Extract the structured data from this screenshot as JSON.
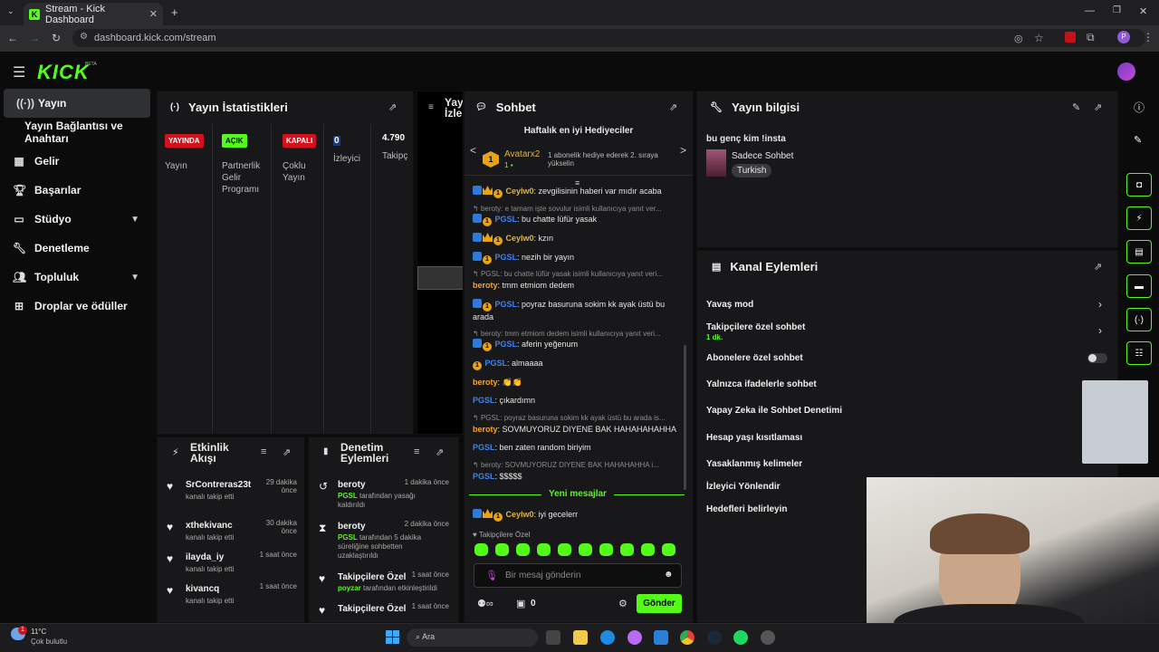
{
  "browser": {
    "tab_title": "Stream - Kick Dashboard",
    "url": "dashboard.kick.com/stream"
  },
  "kick": {
    "logo": "KICK",
    "beta": "BETA"
  },
  "sidebar": {
    "items": [
      {
        "label": "Yayın",
        "icon": "broadcast-icon",
        "active": true
      },
      {
        "label": "Yayın Bağlantısı ve Anahtarı",
        "icon": "",
        "active": false
      },
      {
        "label": "Gelir",
        "icon": "revenue-icon"
      },
      {
        "label": "Başarılar",
        "icon": "trophy-icon"
      },
      {
        "label": "Stüdyo",
        "icon": "studio-icon"
      },
      {
        "label": "Denetleme",
        "icon": "wrench-icon"
      },
      {
        "label": "Topluluk",
        "icon": "community-icon"
      },
      {
        "label": "Droplar ve ödüller",
        "icon": "drops-icon"
      }
    ]
  },
  "stats": {
    "title": "Yayın İstatistikleri",
    "cols": [
      {
        "badge": "YAYINDA",
        "badge_color": "#d4101c",
        "label": "Yayın"
      },
      {
        "badge": "AÇIK",
        "badge_color": "#53fc18",
        "label": "Partnerlik Gelir Programı"
      },
      {
        "badge": "KAPALI",
        "badge_color": "#d4101c",
        "label": "Çoklu Yayın"
      },
      {
        "value": "0",
        "label": "İzleyici"
      },
      {
        "value": "4.790",
        "label": "Takipç"
      }
    ]
  },
  "player": {
    "title_line1": "Yay",
    "title_line2": "İzle"
  },
  "chat": {
    "title": "Sohbet",
    "top_gifters_title": "Haftalık en iyi Hediyeciler",
    "gifter_name": "Avatarx2",
    "gifter_count": "1",
    "gifter_note": "1 abonelik hediye ederek 2. sıraya yükselin",
    "messages": [
      {
        "user": "Ceylw0",
        "text": ": zevgilisinin haberi var mıdır acaba",
        "color": "gold"
      },
      {
        "reply": "beroty: e tamam işte sovulur isimli kullanıcıya yanıt ver..."
      },
      {
        "user": "PGSL",
        "text": ": bu chatte lüfür yasak",
        "color": "blue"
      },
      {
        "user": "Ceylw0",
        "text": ": kzın",
        "color": "gold"
      },
      {
        "user": "PGSL",
        "text": ": nezih bir yayın",
        "color": "blue"
      },
      {
        "reply": "PGSL: bu chatte lüfür yasak isimli kullanıcıya yanıt veri..."
      },
      {
        "user": "beroty",
        "text": ": tmm etmiom dedem",
        "color": "org"
      },
      {
        "user": "PGSL",
        "text": ": poyraz basuruna sokim kk ayak üstü bu arada",
        "color": "blue"
      },
      {
        "reply": "beroty: tmm etmiom dedem isimli kullanıcıya yanıt veri..."
      },
      {
        "user": "PGSL",
        "text": ": aferin yeğenum",
        "color": "blue"
      },
      {
        "user": "PGSL",
        "text": ": almaaaa",
        "color": "blue"
      },
      {
        "user": "beroty",
        "text": ": 👏👏",
        "color": "org"
      },
      {
        "user": "PGSL",
        "text": ": çıkardımn",
        "color": "blue"
      },
      {
        "reply": "PGSL: poyraz basuruna sokim kk ayak üstü bu arada is..."
      },
      {
        "user": "beroty",
        "text": ": SOVMUYORUZ DIYENE BAK HAHAHAHAHHA",
        "color": "org"
      },
      {
        "user": "PGSL",
        "text": ": ben zaten random biriyim",
        "color": "blue"
      },
      {
        "reply": "beroty: SOVMUYORUZ DIYENE BAK HAHAHAHHA i..."
      },
      {
        "user": "PGSL",
        "text": ": $$$$$",
        "color": "blue"
      }
    ],
    "new_messages": "Yeni mesajlar",
    "last_msg_user": "Ceylw0",
    "last_msg_text": ": iyi gecelerr",
    "followers_only": "Takipçilere Özel",
    "input_placeholder": "Bir mesaj gönderin",
    "footer_count": "0",
    "send": "Gönder"
  },
  "stream_info": {
    "title": "Yayın bilgisi",
    "stream_title": "bu genç kim !insta",
    "category": "Sadece Sohbet",
    "tag": "Turkish"
  },
  "channel_actions": {
    "title": "Kanal Eylemleri",
    "rows": [
      {
        "label": "Yavaş mod"
      },
      {
        "label": "Takipçilere özel sohbet",
        "sub": "1 dk."
      },
      {
        "label": "Abonelere özel sohbet"
      },
      {
        "label": "Yalnızca ifadelerle sohbet"
      },
      {
        "label": "Yapay Zeka ile Sohbet Denetimi"
      },
      {
        "label": "Hesap yaşı kısıtlaması"
      },
      {
        "label": "Yasaklanmış kelimeler"
      },
      {
        "label": "İzleyici Yönlendir"
      },
      {
        "label": "Hedefleri belirleyin"
      }
    ]
  },
  "activity": {
    "title_line1": "Etkinlik",
    "title_line2": "Akışı",
    "items": [
      {
        "name": "SrContreras23t",
        "sub": "kanalı takip etti",
        "time": "29 dakika önce"
      },
      {
        "name": "xthekivanc",
        "sub": "kanalı takip etti",
        "time": "30 dakika önce"
      },
      {
        "name": "ilayda_iy",
        "sub": "kanalı takip etti",
        "time": "1 saat önce"
      },
      {
        "name": "kivancq",
        "sub": "kanalı takip etti",
        "time": "1 saat önce"
      }
    ]
  },
  "moderation": {
    "title_line1": "Denetim",
    "title_line2": "Eylemleri",
    "items": [
      {
        "name": "beroty",
        "actor": "PGSL",
        "sub": " tarafından yasağı kaldırıldı",
        "time": "1 dakika önce"
      },
      {
        "name": "beroty",
        "actor": "PGSL",
        "sub": " tarafından 5 dakika süreliğine sohbetten uzaklaştırıldı",
        "time": "2 dakika önce"
      },
      {
        "name": "Takipçilere Özel",
        "actor": "poyzar",
        "sub": " tarafından etkinleştirildi",
        "time": "1 saat önce"
      },
      {
        "name": "Takipçilere Özel",
        "actor": "",
        "sub": "",
        "time": "1 saat önce"
      }
    ]
  },
  "taskbar": {
    "temp": "11°C",
    "weather": "Çok bulutlu",
    "search": "Ara"
  },
  "colors": {
    "accent": "#53fc18",
    "bg": "#0b0b0c",
    "panel": "#18181a"
  }
}
